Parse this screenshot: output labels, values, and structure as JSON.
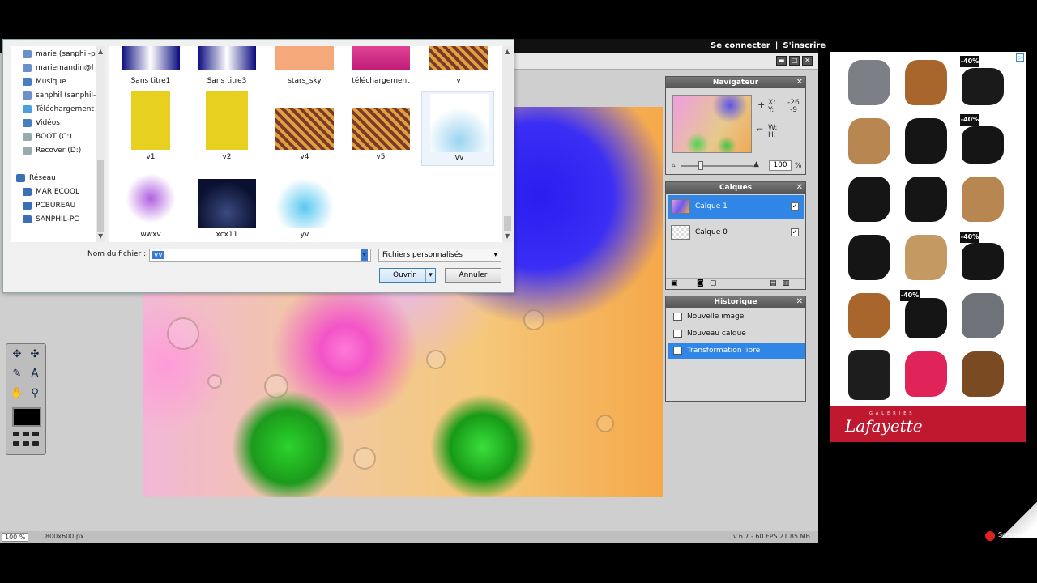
{
  "header": {
    "login": "Se connecter",
    "separator": "|",
    "signup": "S'inscrire"
  },
  "window_controls": {
    "minimize": "▬",
    "maximize": "□",
    "close": "✕"
  },
  "panels": {
    "navigator": {
      "title": "Navigateur",
      "x_label": "X:",
      "x_value": "-26",
      "y_label": "Y:",
      "y_value": "-9",
      "w_label": "W:",
      "h_label": "H:",
      "zoom_value": "100",
      "zoom_unit": "%"
    },
    "layers": {
      "title": "Calques",
      "items": [
        {
          "name": "Calque 1",
          "checked": "✓"
        },
        {
          "name": "Calque 0",
          "checked": "✓"
        }
      ]
    },
    "history": {
      "title": "Historique",
      "items": [
        "Nouvelle image",
        "Nouveau calque",
        "Transformation libre"
      ]
    }
  },
  "status_bar": {
    "zoom": "100 %",
    "dimensions": "800x600 px",
    "version": "v.6.7 - 60 FPS 21.85 MB"
  },
  "dialog": {
    "tree": [
      "marie (sanphil-p",
      "mariemandin@l",
      "Musique",
      "sanphil (sanphil-",
      "Téléchargement",
      "Vidéos",
      "BOOT (C:)",
      "Recover (D:)",
      "Réseau",
      "MARIECOOL",
      "PCBUREAU",
      "SANPHIL-PC"
    ],
    "files": [
      "Sans titre1",
      "Sans titre3",
      "stars_sky",
      "téléchargement",
      "v",
      "v1",
      "v2",
      "v4",
      "v5",
      "vv",
      "wwxv",
      "xcx11",
      "yv"
    ],
    "filename_label": "Nom du fichier :",
    "filename_value": "vv",
    "filetype_value": "Fichiers personnalisés",
    "open_label": "Ouvrir",
    "cancel_label": "Annuler"
  },
  "ad": {
    "badge": "-40%",
    "brand_top": "GALERIES",
    "brand": "Lafayette"
  },
  "watermark": "Screenpresso"
}
